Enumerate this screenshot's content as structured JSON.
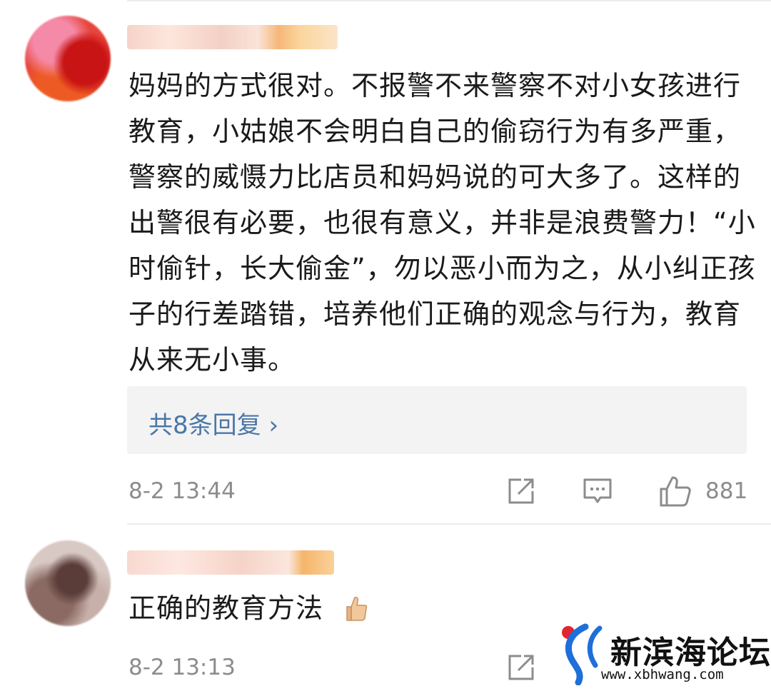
{
  "comments": [
    {
      "text": "妈妈的方式很对。不报警不来警察不对小女孩进行教育，小姑娘不会明白自己的偷窃行为有多严重，警察的威慑力比店员和妈妈说的可大多了。这样的出警很有必要，也很有意义，并非是浪费警力！“小时偷针，长大偷金”，勿以恶小而为之，从小纠正孩子的行差踏错，培养他们正确的观念与行为，教育从来无小事。",
      "reply_label": "共8条回复 ›",
      "timestamp": "8-2 13:44",
      "likes": "881"
    },
    {
      "text": "正确的教育方法",
      "timestamp": "8-2 13:13"
    }
  ],
  "watermark": {
    "title": "新滨海论坛",
    "url": "www.xbhwang.com"
  },
  "icons": {
    "share": "share-icon",
    "comment": "comment-icon",
    "like": "thumbs-up-icon",
    "emoji": "thumbs-up-emoji"
  },
  "colors": {
    "reply_link": "#4b77a8",
    "meta_gray": "#8c8c8c",
    "watermark_blue": "#1e6fd9",
    "watermark_red": "#e0262f"
  }
}
